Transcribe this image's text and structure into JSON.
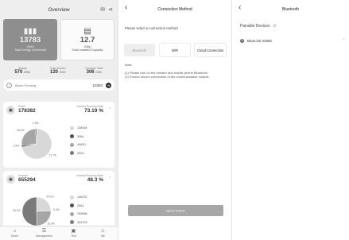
{
  "overview": {
    "title": "Overview",
    "icons": {
      "message": "chat-icon",
      "share": "share-icon"
    },
    "energy": {
      "value": "13783",
      "unit": "GWh",
      "label": "Total Energy Generated",
      "icon": "bar-chart-icon"
    },
    "capacity": {
      "value": "12.7",
      "unit": "GWp",
      "label": "Total Installed Capacity",
      "icon": "solar-panel-icon"
    },
    "stats": [
      {
        "label": "Today",
        "value": "570",
        "unit": "MWh"
      },
      {
        "label": "This Month",
        "value": "120",
        "unit": "GWh"
      },
      {
        "label": "Current Year",
        "value": "306",
        "unit": "GWh"
      }
    ],
    "alarm": {
      "label": "Alarm Pending",
      "count": "10353"
    },
    "plants": {
      "name": "Plant",
      "count": "178382",
      "rate_label": "Normal Running Rate",
      "rate": "73.19 %",
      "legend": [
        "128064",
        "3364",
        "44630",
        "2604"
      ],
      "pie_values": [
        128064,
        3364,
        44630,
        2604
      ],
      "pie_labels": [
        "71.7%",
        "1.9%",
        "25.0%",
        "1.5%"
      ],
      "colors": [
        "#d8d8d8",
        "#505050",
        "#a6a6a6",
        "#7a7a7a"
      ]
    },
    "inverters": {
      "name": "Inverter",
      "count": "655294",
      "rate_label": "Normal Running Rate",
      "rate": "48.3 %",
      "legend": [
        "146292",
        "2581",
        "153888",
        "304703"
      ],
      "pie_values": [
        146292,
        2581,
        153888,
        304703
      ],
      "pie_labels": [
        "24.1%",
        "0.4%",
        "25.3%",
        "50.2%"
      ],
      "colors": [
        "#d8d8d8",
        "#505050",
        "#a6a6a6",
        "#7a7a7a"
      ]
    },
    "tabs": [
      {
        "label": "Home",
        "icon": "home-icon"
      },
      {
        "label": "Management",
        "icon": "management-icon"
      },
      {
        "label": "Tool",
        "icon": "tool-icon"
      },
      {
        "label": "Me",
        "icon": "user-icon"
      }
    ]
  },
  "connection": {
    "title": "Connection Method",
    "prompt": "Please select a connection method",
    "methods": [
      "Bluetooth",
      "WiFi",
      "Cloud Connection"
    ],
    "note_title": "Note:",
    "note_1": "(1) Please turn on the inverter and mobile phone Bluetooth.",
    "note_2": "(2) Ensure secure connection of the communication module.",
    "next": "NEXT STEP"
  },
  "bluetooth": {
    "title": "Bluetooth",
    "section": "Pairable Devices",
    "device": "BlueLink 02982"
  }
}
